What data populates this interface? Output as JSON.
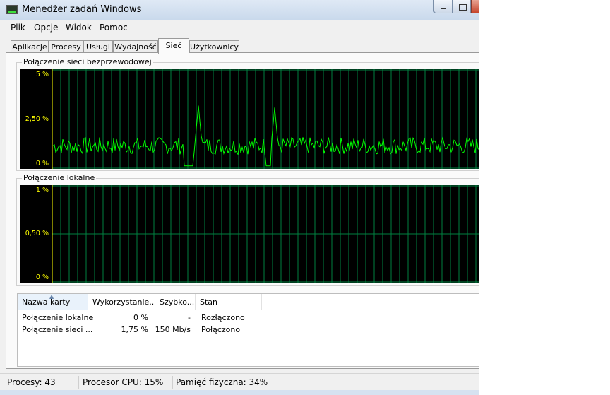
{
  "window": {
    "title": "Menedżer zadań Windows"
  },
  "menu": [
    "Plik",
    "Opcje",
    "Widok",
    "Pomoc"
  ],
  "tabs": [
    "Aplikacje",
    "Procesy",
    "Usługi",
    "Wydajność",
    "Sieć",
    "Użytkownicy"
  ],
  "active_tab": "Sieć",
  "graphs": [
    {
      "title": "Połączenie sieci bezprzewodowej",
      "y_labels": [
        "5 %",
        "2,50 %",
        "0 %"
      ],
      "ylim": [
        0,
        5
      ]
    },
    {
      "title": "Połączenie lokalne",
      "y_labels": [
        "1 %",
        "0,50 %",
        "0 %"
      ],
      "ylim": [
        0,
        1
      ]
    }
  ],
  "table": {
    "columns": [
      "Nazwa karty",
      "Wykorzystanie...",
      "Szybko...",
      "Stan"
    ],
    "rows": [
      [
        "Połączenie lokalne",
        "0 %",
        "-",
        "Rozłączono"
      ],
      [
        "Połączenie sieci ...",
        "1,75 %",
        "150 Mb/s",
        "Połączono"
      ]
    ]
  },
  "status": {
    "processes": "Procesy: 43",
    "cpu": "Procesor CPU: 15%",
    "memory": "Pamięć fizyczna: 34%"
  },
  "colors": {
    "graph_bg": "#000000",
    "grid": "#008040",
    "line": "#00ff00",
    "label": "#ffff00"
  }
}
